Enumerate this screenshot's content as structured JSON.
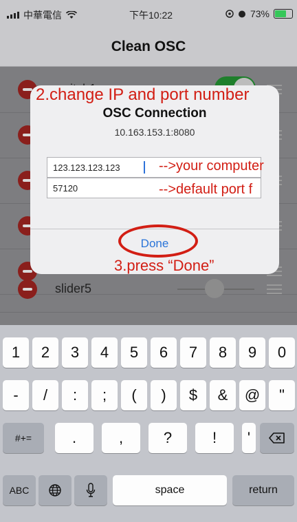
{
  "status_bar": {
    "carrier": "中華電信",
    "wifi_icon": "wifi-icon",
    "time": "下午10:22",
    "battery_percent": "73%",
    "battery_level": 0.73
  },
  "navbar": {
    "title": "Clean OSC"
  },
  "list": {
    "rows": [
      {
        "label": "switch1"
      },
      {
        "label": ""
      },
      {
        "label": ""
      },
      {
        "label": ""
      },
      {
        "label": ""
      },
      {
        "label": "slider5"
      }
    ]
  },
  "dialog": {
    "title": "OSC Connection",
    "subtitle": "10.163.153.1:8080",
    "ip_value": "123.123.123.123",
    "port_value": "57120",
    "done_label": "Done"
  },
  "annotations": {
    "step2": "2.change IP and port number",
    "computer": "-->your computer",
    "port": "-->default port f",
    "step3": "3.press “Done”",
    "color": "#d21e14"
  },
  "keyboard": {
    "row1": [
      "1",
      "2",
      "3",
      "4",
      "5",
      "6",
      "7",
      "8",
      "9",
      "0"
    ],
    "row2": [
      "-",
      "/",
      ":",
      ";",
      "(",
      ")",
      "$",
      "&",
      "@",
      "\""
    ],
    "row3_toggle": "#+=",
    "row3": [
      ".",
      ",",
      "?",
      "!",
      "'"
    ],
    "backspace_icon": "backspace-icon",
    "abc": "ABC",
    "globe_icon": "globe-icon",
    "mic_icon": "microphone-icon",
    "space": "space",
    "return": "return"
  }
}
